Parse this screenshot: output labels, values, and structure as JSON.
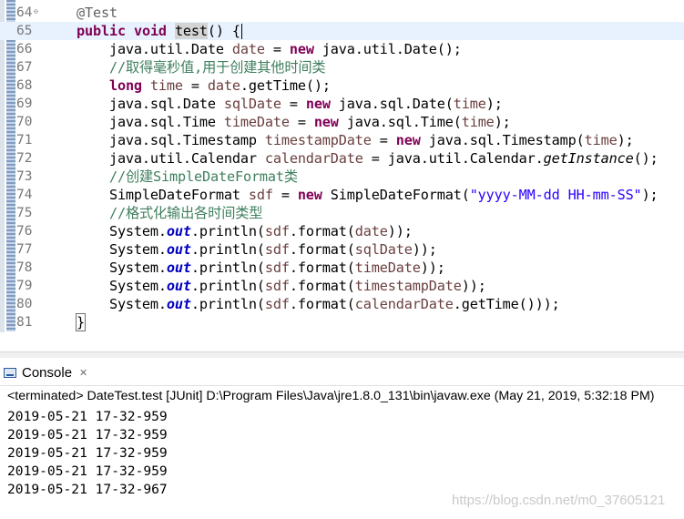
{
  "editor": {
    "lines": [
      {
        "num": "64",
        "fold": "⊖",
        "segments": [
          {
            "t": "    "
          },
          {
            "t": "@Test",
            "c": "ann"
          }
        ]
      },
      {
        "num": "65",
        "current": true,
        "segments": [
          {
            "t": "    "
          },
          {
            "t": "public",
            "c": "kw"
          },
          {
            "t": " "
          },
          {
            "t": "void",
            "c": "kw"
          },
          {
            "t": " "
          },
          {
            "t": "test",
            "c": "hl"
          },
          {
            "t": "() {"
          },
          {
            "caret": true
          }
        ]
      },
      {
        "num": "66",
        "segments": [
          {
            "t": "        java.util.Date "
          },
          {
            "t": "date",
            "c": "var"
          },
          {
            "t": " = "
          },
          {
            "t": "new",
            "c": "kw"
          },
          {
            "t": " java.util.Date();"
          }
        ]
      },
      {
        "num": "67",
        "segments": [
          {
            "t": "        "
          },
          {
            "t": "//取得毫秒值,用于创建其他时间类",
            "c": "cm"
          }
        ]
      },
      {
        "num": "68",
        "segments": [
          {
            "t": "        "
          },
          {
            "t": "long",
            "c": "kw"
          },
          {
            "t": " "
          },
          {
            "t": "time",
            "c": "var"
          },
          {
            "t": " = "
          },
          {
            "t": "date",
            "c": "var"
          },
          {
            "t": ".getTime();"
          }
        ]
      },
      {
        "num": "69",
        "segments": [
          {
            "t": "        java.sql.Date "
          },
          {
            "t": "sqlDate",
            "c": "var"
          },
          {
            "t": " = "
          },
          {
            "t": "new",
            "c": "kw"
          },
          {
            "t": " java.sql.Date("
          },
          {
            "t": "time",
            "c": "var"
          },
          {
            "t": ");"
          }
        ]
      },
      {
        "num": "70",
        "segments": [
          {
            "t": "        java.sql.Time "
          },
          {
            "t": "timeDate",
            "c": "var"
          },
          {
            "t": " = "
          },
          {
            "t": "new",
            "c": "kw"
          },
          {
            "t": " java.sql.Time("
          },
          {
            "t": "time",
            "c": "var"
          },
          {
            "t": ");"
          }
        ]
      },
      {
        "num": "71",
        "segments": [
          {
            "t": "        java.sql.Timestamp "
          },
          {
            "t": "timestampDate",
            "c": "var"
          },
          {
            "t": " = "
          },
          {
            "t": "new",
            "c": "kw"
          },
          {
            "t": " java.sql.Timestamp("
          },
          {
            "t": "time",
            "c": "var"
          },
          {
            "t": ");"
          }
        ]
      },
      {
        "num": "72",
        "segments": [
          {
            "t": "        java.util.Calendar "
          },
          {
            "t": "calendarDate",
            "c": "var"
          },
          {
            "t": " = java.util.Calendar."
          },
          {
            "t": "getInstance",
            "c": "st"
          },
          {
            "t": "();"
          }
        ]
      },
      {
        "num": "73",
        "segments": [
          {
            "t": "        "
          },
          {
            "t": "//创建SimpleDateFormat类",
            "c": "cm"
          }
        ]
      },
      {
        "num": "74",
        "segments": [
          {
            "t": "        SimpleDateFormat "
          },
          {
            "t": "sdf",
            "c": "var"
          },
          {
            "t": " = "
          },
          {
            "t": "new",
            "c": "kw"
          },
          {
            "t": " SimpleDateFormat("
          },
          {
            "t": "\"yyyy-MM-dd HH-mm-SS\"",
            "c": "str"
          },
          {
            "t": ");"
          }
        ]
      },
      {
        "num": "75",
        "segments": [
          {
            "t": "        "
          },
          {
            "t": "//格式化输出各时间类型",
            "c": "cm"
          }
        ]
      },
      {
        "num": "76",
        "segments": [
          {
            "t": "        System."
          },
          {
            "t": "out",
            "c": "fld"
          },
          {
            "t": ".println("
          },
          {
            "t": "sdf",
            "c": "var"
          },
          {
            "t": ".format("
          },
          {
            "t": "date",
            "c": "var"
          },
          {
            "t": "));"
          }
        ]
      },
      {
        "num": "77",
        "segments": [
          {
            "t": "        System."
          },
          {
            "t": "out",
            "c": "fld"
          },
          {
            "t": ".println("
          },
          {
            "t": "sdf",
            "c": "var"
          },
          {
            "t": ".format("
          },
          {
            "t": "sqlDate",
            "c": "var"
          },
          {
            "t": "));"
          }
        ]
      },
      {
        "num": "78",
        "segments": [
          {
            "t": "        System."
          },
          {
            "t": "out",
            "c": "fld"
          },
          {
            "t": ".println("
          },
          {
            "t": "sdf",
            "c": "var"
          },
          {
            "t": ".format("
          },
          {
            "t": "timeDate",
            "c": "var"
          },
          {
            "t": "));"
          }
        ]
      },
      {
        "num": "79",
        "segments": [
          {
            "t": "        System."
          },
          {
            "t": "out",
            "c": "fld"
          },
          {
            "t": ".println("
          },
          {
            "t": "sdf",
            "c": "var"
          },
          {
            "t": ".format("
          },
          {
            "t": "timestampDate",
            "c": "var"
          },
          {
            "t": "));"
          }
        ]
      },
      {
        "num": "80",
        "segments": [
          {
            "t": "        System."
          },
          {
            "t": "out",
            "c": "fld"
          },
          {
            "t": ".println("
          },
          {
            "t": "sdf",
            "c": "var"
          },
          {
            "t": ".format("
          },
          {
            "t": "calendarDate",
            "c": "var"
          },
          {
            "t": ".getTime()));"
          }
        ]
      },
      {
        "num": "81",
        "segments": [
          {
            "t": "    "
          },
          {
            "t": "}",
            "c": "bracket-box"
          }
        ]
      }
    ],
    "scroll_arrow": "<"
  },
  "console": {
    "tab_label": "Console",
    "close_glyph": "✕",
    "status": "<terminated> DateTest.test [JUnit] D:\\Program Files\\Java\\jre1.8.0_131\\bin\\javaw.exe (May 21, 2019, 5:32:18 PM)",
    "output": [
      "2019-05-21 17-32-959",
      "2019-05-21 17-32-959",
      "2019-05-21 17-32-959",
      "2019-05-21 17-32-959",
      "2019-05-21 17-32-967"
    ],
    "watermark": "https://blog.csdn.net/m0_37605121"
  },
  "colors": {
    "keyword": "#7f0055",
    "comment": "#3f7f5f",
    "string": "#2a00ff",
    "local_var": "#6a3e3e",
    "static_field": "#0000c0",
    "current_line": "#e8f2fe"
  }
}
